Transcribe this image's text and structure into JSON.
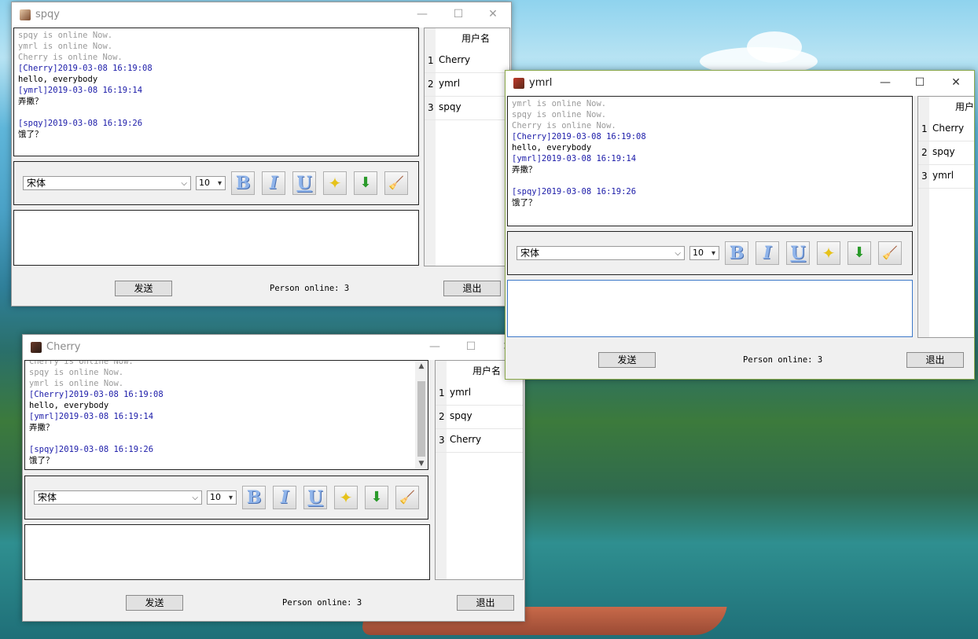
{
  "common": {
    "font_value": "宋体",
    "size_value": "10",
    "send_label": "发送",
    "exit_label": "退出",
    "users_header": "用户名",
    "status_text": "Person online: 3",
    "minimize": "—",
    "maximize": "☐",
    "close": "✕"
  },
  "windows": {
    "spqy": {
      "title": "spqy",
      "log": {
        "l1": "spqy is online Now.",
        "l2": "ymrl is online Now.",
        "l3": "Cherry is online Now.",
        "l4": "[Cherry]2019-03-08 16:19:08",
        "l5": "hello, everybody",
        "l6": "[ymrl]2019-03-08 16:19:14",
        "l7": "弄撒？",
        "l8": "[spqy]2019-03-08 16:19:26",
        "l9": "饿了？"
      },
      "users": [
        "Cherry",
        "ymrl",
        "spqy"
      ]
    },
    "ymrl": {
      "title": "ymrl",
      "log": {
        "l1": "ymrl is online Now.",
        "l2": "spqy is online Now.",
        "l3": "Cherry is online Now.",
        "l4": "[Cherry]2019-03-08 16:19:08",
        "l5": "hello, everybody",
        "l6": "[ymrl]2019-03-08 16:19:14",
        "l7": "弄撒？",
        "l8": "[spqy]2019-03-08 16:19:26",
        "l9": "饿了？"
      },
      "users": [
        "Cherry",
        "spqy",
        "ymrl"
      ],
      "users_header": "用户"
    },
    "cherry": {
      "title": "Cherry",
      "log": {
        "l1": "Cherry is online Now.",
        "l2": "spqy is online Now.",
        "l3": "ymrl is online Now.",
        "l4": "[Cherry]2019-03-08 16:19:08",
        "l5": "hello, everybody",
        "l6": "[ymrl]2019-03-08 16:19:14",
        "l7": "弄撒？",
        "l8": "[spqy]2019-03-08 16:19:26",
        "l9": "饿了？"
      },
      "users": [
        "ymrl",
        "spqy",
        "Cherry"
      ]
    }
  },
  "row_numbers": [
    "1",
    "2",
    "3"
  ],
  "toolbar_icons": [
    "bold-icon",
    "italic-icon",
    "underline-icon",
    "star-icon",
    "save-download-icon",
    "clear-broom-icon"
  ],
  "toolbar_glyphs": {
    "bold": "B",
    "italic": "I",
    "underline": "U",
    "star": "✦",
    "save": "⬇",
    "clear": "🧹"
  }
}
